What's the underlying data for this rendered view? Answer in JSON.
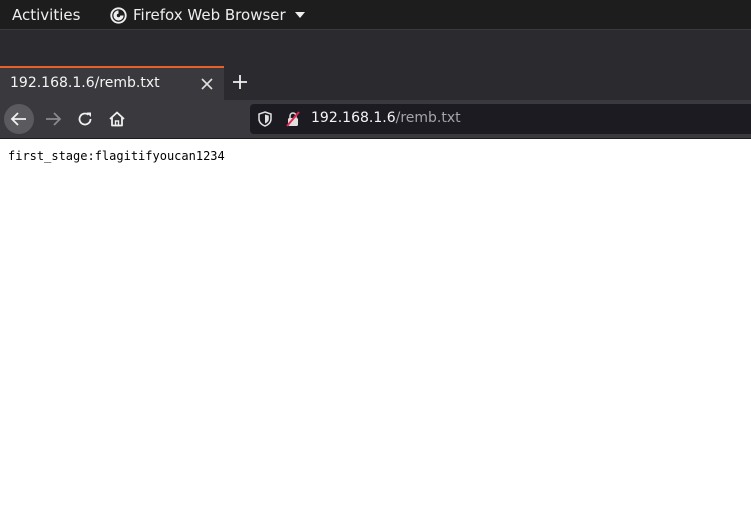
{
  "topbar": {
    "activities_label": "Activities",
    "app_name": "Firefox Web Browser"
  },
  "tab": {
    "title": "192.168.1.6/remb.txt",
    "icons": {
      "close": "close-icon",
      "new_tab": "plus-icon"
    }
  },
  "navbar": {
    "url_host": "192.168.1.6",
    "url_path": "/remb.txt",
    "icons": {
      "back": "back-arrow-icon",
      "forward": "forward-arrow-icon",
      "reload": "reload-icon",
      "home": "home-icon",
      "shield": "shield-icon",
      "connection": "insecure-lock-icon"
    }
  },
  "content": {
    "text": "first_stage:flagitifyoucan1234"
  },
  "colors": {
    "tab_accent": "#e8602c",
    "insecure_slash": "#e22850",
    "topbar_bg": "#1d1d1d",
    "toolbar_bg": "#3a393d"
  }
}
